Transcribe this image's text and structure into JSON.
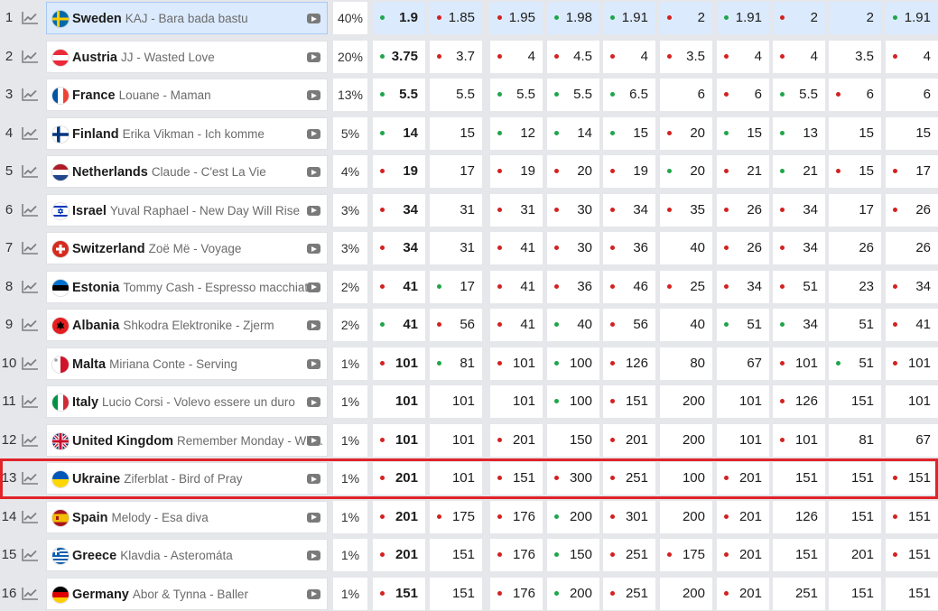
{
  "rows": [
    {
      "rank": "1",
      "country": "Sweden",
      "song": "KAJ - Bara bada bastu",
      "pct": "40%",
      "flag": "sweden-flag-icon",
      "leader": true,
      "odds": [
        {
          "v": "1.9",
          "d": "green",
          "best": true
        },
        {
          "v": "1.85",
          "d": "red"
        },
        {
          "v": "1.95",
          "d": "red"
        },
        {
          "v": "1.98",
          "d": "green"
        },
        {
          "v": "1.91",
          "d": "green"
        },
        {
          "v": "2",
          "d": "red"
        },
        {
          "v": "1.91",
          "d": "green"
        },
        {
          "v": "2",
          "d": "red"
        },
        {
          "v": "2",
          "d": ""
        },
        {
          "v": "1.91",
          "d": "green"
        }
      ]
    },
    {
      "rank": "2",
      "country": "Austria",
      "song": "JJ - Wasted Love",
      "pct": "20%",
      "flag": "austria-flag-icon",
      "odds": [
        {
          "v": "3.75",
          "d": "green",
          "best": true
        },
        {
          "v": "3.7",
          "d": "red"
        },
        {
          "v": "4",
          "d": "red"
        },
        {
          "v": "4.5",
          "d": "red"
        },
        {
          "v": "4",
          "d": "red"
        },
        {
          "v": "3.5",
          "d": "red"
        },
        {
          "v": "4",
          "d": "red"
        },
        {
          "v": "4",
          "d": "red"
        },
        {
          "v": "3.5",
          "d": ""
        },
        {
          "v": "4",
          "d": "red"
        }
      ]
    },
    {
      "rank": "3",
      "country": "France",
      "song": "Louane - Maman",
      "pct": "13%",
      "flag": "france-flag-icon",
      "odds": [
        {
          "v": "5.5",
          "d": "green",
          "best": true
        },
        {
          "v": "5.5",
          "d": ""
        },
        {
          "v": "5.5",
          "d": "green"
        },
        {
          "v": "5.5",
          "d": "green"
        },
        {
          "v": "6.5",
          "d": "green"
        },
        {
          "v": "6",
          "d": ""
        },
        {
          "v": "6",
          "d": "red"
        },
        {
          "v": "5.5",
          "d": "green"
        },
        {
          "v": "6",
          "d": "red"
        },
        {
          "v": "6",
          "d": ""
        }
      ]
    },
    {
      "rank": "4",
      "country": "Finland",
      "song": "Erika Vikman - Ich komme",
      "pct": "5%",
      "flag": "finland-flag-icon",
      "odds": [
        {
          "v": "14",
          "d": "green",
          "best": true
        },
        {
          "v": "15",
          "d": ""
        },
        {
          "v": "12",
          "d": "green"
        },
        {
          "v": "14",
          "d": "green"
        },
        {
          "v": "15",
          "d": "green"
        },
        {
          "v": "20",
          "d": "red"
        },
        {
          "v": "15",
          "d": "green"
        },
        {
          "v": "13",
          "d": "green"
        },
        {
          "v": "15",
          "d": ""
        },
        {
          "v": "15",
          "d": ""
        }
      ]
    },
    {
      "rank": "5",
      "country": "Netherlands",
      "song": "Claude - C'est La Vie",
      "pct": "4%",
      "flag": "netherlands-flag-icon",
      "odds": [
        {
          "v": "19",
          "d": "red",
          "best": true
        },
        {
          "v": "17",
          "d": ""
        },
        {
          "v": "19",
          "d": "red"
        },
        {
          "v": "20",
          "d": "red"
        },
        {
          "v": "19",
          "d": "red"
        },
        {
          "v": "20",
          "d": "green"
        },
        {
          "v": "21",
          "d": "red"
        },
        {
          "v": "21",
          "d": "green"
        },
        {
          "v": "15",
          "d": "red"
        },
        {
          "v": "17",
          "d": "red"
        }
      ]
    },
    {
      "rank": "6",
      "country": "Israel",
      "song": "Yuval Raphael - New Day Will Rise",
      "pct": "3%",
      "flag": "israel-flag-icon",
      "odds": [
        {
          "v": "34",
          "d": "red",
          "best": true
        },
        {
          "v": "31",
          "d": ""
        },
        {
          "v": "31",
          "d": "red"
        },
        {
          "v": "30",
          "d": "red"
        },
        {
          "v": "34",
          "d": "red"
        },
        {
          "v": "35",
          "d": "red"
        },
        {
          "v": "26",
          "d": "red"
        },
        {
          "v": "34",
          "d": "red"
        },
        {
          "v": "17",
          "d": ""
        },
        {
          "v": "26",
          "d": "red"
        }
      ]
    },
    {
      "rank": "7",
      "country": "Switzerland",
      "song": "Zoë Më - Voyage",
      "pct": "3%",
      "flag": "switzerland-flag-icon",
      "odds": [
        {
          "v": "34",
          "d": "red",
          "best": true
        },
        {
          "v": "31",
          "d": ""
        },
        {
          "v": "41",
          "d": "red"
        },
        {
          "v": "30",
          "d": "red"
        },
        {
          "v": "36",
          "d": "red"
        },
        {
          "v": "40",
          "d": ""
        },
        {
          "v": "26",
          "d": "red"
        },
        {
          "v": "34",
          "d": "red"
        },
        {
          "v": "26",
          "d": ""
        },
        {
          "v": "26",
          "d": ""
        }
      ]
    },
    {
      "rank": "8",
      "country": "Estonia",
      "song": "Tommy Cash - Espresso macchiato",
      "pct": "2%",
      "flag": "estonia-flag-icon",
      "odds": [
        {
          "v": "41",
          "d": "red",
          "best": true
        },
        {
          "v": "17",
          "d": "green"
        },
        {
          "v": "41",
          "d": "red"
        },
        {
          "v": "36",
          "d": "red"
        },
        {
          "v": "46",
          "d": "red"
        },
        {
          "v": "25",
          "d": "red"
        },
        {
          "v": "34",
          "d": "red"
        },
        {
          "v": "51",
          "d": "red"
        },
        {
          "v": "23",
          "d": ""
        },
        {
          "v": "34",
          "d": "red"
        }
      ]
    },
    {
      "rank": "9",
      "country": "Albania",
      "song": "Shkodra Elektronike - Zjerm",
      "pct": "2%",
      "flag": "albania-flag-icon",
      "odds": [
        {
          "v": "41",
          "d": "green",
          "best": true
        },
        {
          "v": "56",
          "d": "red"
        },
        {
          "v": "41",
          "d": "red"
        },
        {
          "v": "40",
          "d": "green"
        },
        {
          "v": "56",
          "d": "red"
        },
        {
          "v": "40",
          "d": ""
        },
        {
          "v": "51",
          "d": "green"
        },
        {
          "v": "34",
          "d": "green"
        },
        {
          "v": "51",
          "d": ""
        },
        {
          "v": "41",
          "d": "red"
        }
      ]
    },
    {
      "rank": "10",
      "country": "Malta",
      "song": "Miriana Conte - Serving",
      "pct": "1%",
      "flag": "malta-flag-icon",
      "odds": [
        {
          "v": "101",
          "d": "red",
          "best": true
        },
        {
          "v": "81",
          "d": "green"
        },
        {
          "v": "101",
          "d": "red"
        },
        {
          "v": "100",
          "d": "green"
        },
        {
          "v": "126",
          "d": "red"
        },
        {
          "v": "80",
          "d": ""
        },
        {
          "v": "67",
          "d": ""
        },
        {
          "v": "101",
          "d": "red"
        },
        {
          "v": "51",
          "d": "green"
        },
        {
          "v": "101",
          "d": "red"
        }
      ]
    },
    {
      "rank": "11",
      "country": "Italy",
      "song": "Lucio Corsi - Volevo essere un duro",
      "pct": "1%",
      "flag": "italy-flag-icon",
      "odds": [
        {
          "v": "101",
          "d": "",
          "best": true
        },
        {
          "v": "101",
          "d": ""
        },
        {
          "v": "101",
          "d": ""
        },
        {
          "v": "100",
          "d": "green"
        },
        {
          "v": "151",
          "d": "red"
        },
        {
          "v": "200",
          "d": ""
        },
        {
          "v": "101",
          "d": ""
        },
        {
          "v": "126",
          "d": "red"
        },
        {
          "v": "151",
          "d": ""
        },
        {
          "v": "101",
          "d": ""
        }
      ]
    },
    {
      "rank": "12",
      "country": "United Kingdom",
      "song": "Remember Monday - Wh...",
      "pct": "1%",
      "flag": "united-kingdom-flag-icon",
      "odds": [
        {
          "v": "101",
          "d": "red",
          "best": true
        },
        {
          "v": "101",
          "d": ""
        },
        {
          "v": "201",
          "d": "red"
        },
        {
          "v": "150",
          "d": ""
        },
        {
          "v": "201",
          "d": "red"
        },
        {
          "v": "200",
          "d": ""
        },
        {
          "v": "101",
          "d": ""
        },
        {
          "v": "101",
          "d": "red"
        },
        {
          "v": "81",
          "d": ""
        },
        {
          "v": "67",
          "d": ""
        }
      ]
    },
    {
      "rank": "13",
      "country": "Ukraine",
      "song": "Ziferblat - Bird of Pray",
      "pct": "1%",
      "flag": "ukraine-flag-icon",
      "highlight": true,
      "odds": [
        {
          "v": "201",
          "d": "red",
          "best": true
        },
        {
          "v": "101",
          "d": ""
        },
        {
          "v": "151",
          "d": "red"
        },
        {
          "v": "300",
          "d": "red"
        },
        {
          "v": "251",
          "d": "red"
        },
        {
          "v": "100",
          "d": ""
        },
        {
          "v": "201",
          "d": "red"
        },
        {
          "v": "151",
          "d": ""
        },
        {
          "v": "151",
          "d": ""
        },
        {
          "v": "151",
          "d": "red"
        }
      ]
    },
    {
      "rank": "14",
      "country": "Spain",
      "song": "Melody - Esa diva",
      "pct": "1%",
      "flag": "spain-flag-icon",
      "odds": [
        {
          "v": "201",
          "d": "red",
          "best": true
        },
        {
          "v": "175",
          "d": "red"
        },
        {
          "v": "176",
          "d": "red"
        },
        {
          "v": "200",
          "d": "green"
        },
        {
          "v": "301",
          "d": "red"
        },
        {
          "v": "200",
          "d": ""
        },
        {
          "v": "201",
          "d": "red"
        },
        {
          "v": "126",
          "d": ""
        },
        {
          "v": "151",
          "d": ""
        },
        {
          "v": "151",
          "d": "red"
        }
      ]
    },
    {
      "rank": "15",
      "country": "Greece",
      "song": "Klavdia - Asteromáta",
      "pct": "1%",
      "flag": "greece-flag-icon",
      "odds": [
        {
          "v": "201",
          "d": "red",
          "best": true
        },
        {
          "v": "151",
          "d": ""
        },
        {
          "v": "176",
          "d": "red"
        },
        {
          "v": "150",
          "d": "green"
        },
        {
          "v": "251",
          "d": "red"
        },
        {
          "v": "175",
          "d": "red"
        },
        {
          "v": "201",
          "d": "red"
        },
        {
          "v": "151",
          "d": ""
        },
        {
          "v": "201",
          "d": ""
        },
        {
          "v": "151",
          "d": "red"
        }
      ]
    },
    {
      "rank": "16",
      "country": "Germany",
      "song": "Abor & Tynna - Baller",
      "pct": "1%",
      "flag": "germany-flag-icon",
      "odds": [
        {
          "v": "151",
          "d": "red",
          "best": true
        },
        {
          "v": "151",
          "d": ""
        },
        {
          "v": "176",
          "d": "red"
        },
        {
          "v": "200",
          "d": "green"
        },
        {
          "v": "251",
          "d": "red"
        },
        {
          "v": "200",
          "d": ""
        },
        {
          "v": "201",
          "d": "red"
        },
        {
          "v": "251",
          "d": ""
        },
        {
          "v": "151",
          "d": ""
        },
        {
          "v": "151",
          "d": ""
        }
      ]
    }
  ],
  "colors": {
    "dot_red": "#d32121",
    "dot_green": "#1fa54a",
    "leader_bg": "#dbeafd",
    "highlight_border": "#e0242a"
  }
}
